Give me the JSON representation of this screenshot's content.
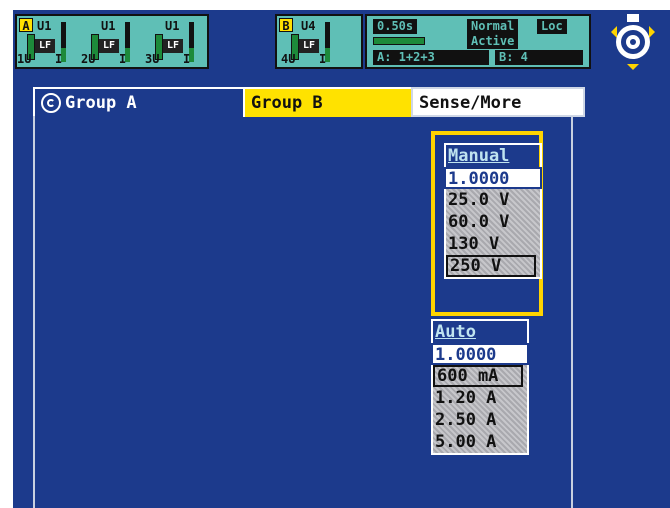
{
  "status_bar": {
    "group_a": {
      "letter": "A",
      "channels": [
        {
          "name": "U1",
          "mode": "LF",
          "number": "1U",
          "flag": "I"
        },
        {
          "name": "U1",
          "mode": "LF",
          "number": "2U",
          "flag": "I"
        },
        {
          "name": "U1",
          "mode": "LF",
          "number": "3U",
          "flag": "I"
        }
      ]
    },
    "group_b": {
      "letter": "B",
      "channels": [
        {
          "name": "U4",
          "mode": "LF",
          "number": "4U",
          "flag": "I"
        }
      ]
    },
    "cycle_time": "0.50s",
    "mode": "Normal",
    "lock": "Loc",
    "state": "Active",
    "group_a_assignment": "A: 1+2+3",
    "group_b_assignment": "B: 4"
  },
  "tabs": [
    {
      "label": "Group A"
    },
    {
      "label": "Group B"
    },
    {
      "label": "Sense/More"
    }
  ],
  "manual_range": {
    "header": "Manual",
    "selected": "1.0000",
    "options": [
      "25.0 V",
      "60.0 V",
      "130 V",
      "250 V"
    ],
    "current": "250 V"
  },
  "auto_range": {
    "header": "Auto",
    "selected": "1.0000",
    "options": [
      "600 mA",
      "1.20 A",
      "2.50 A",
      "5.00 A"
    ],
    "current": "600 mA"
  },
  "colors": {
    "background": "#1c3a8c",
    "status_bg": "#5fbfb6",
    "highlight": "#ffe200",
    "focus_border": "#ffd400"
  },
  "icons": [
    "rotary-knob-icon",
    "tab-dial-icon"
  ]
}
